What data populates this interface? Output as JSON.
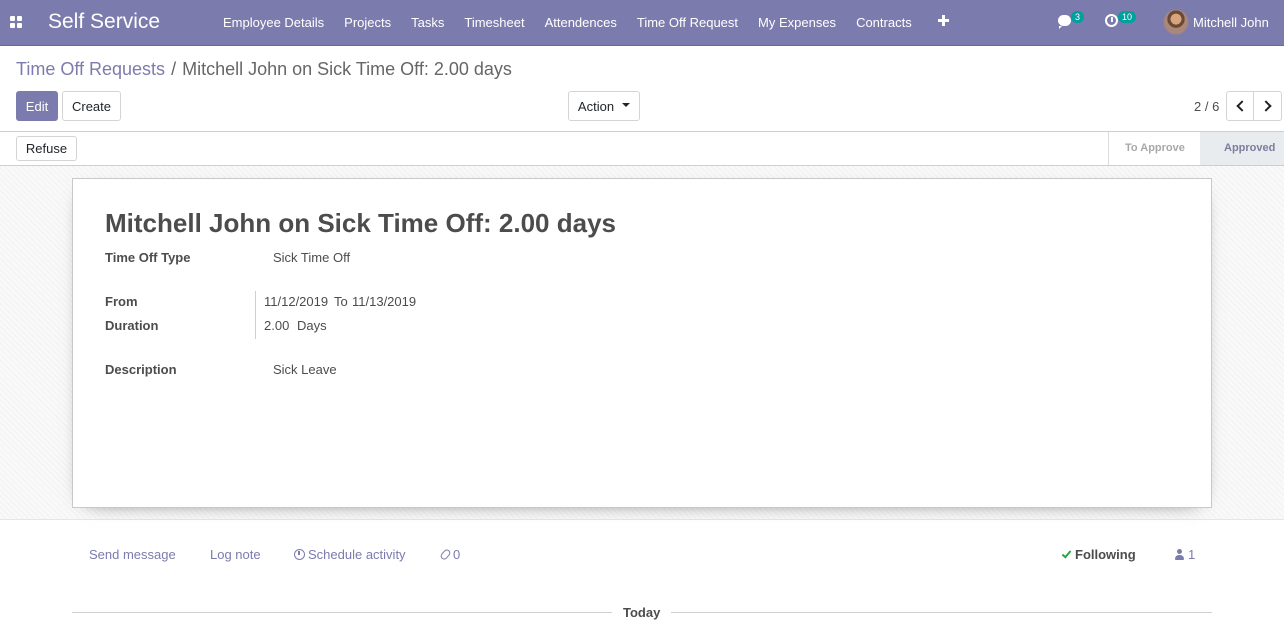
{
  "navbar": {
    "brand": "Self Service",
    "menu": [
      "Employee Details",
      "Projects",
      "Tasks",
      "Timesheet",
      "Attendences",
      "Time Off Request",
      "My Expenses",
      "Contracts"
    ],
    "messages_count": "3",
    "activities_count": "10",
    "user_name": "Mitchell John",
    "accent_color": "#7c7bad"
  },
  "breadcrumb": {
    "parent": "Time Off Requests",
    "separator": "/",
    "current": "Mitchell John on Sick Time Off: 2.00 days"
  },
  "buttons": {
    "edit": "Edit",
    "create": "Create",
    "action": "Action",
    "refuse": "Refuse"
  },
  "pager": {
    "value": "2 / 6"
  },
  "status": {
    "steps": [
      "To Approve",
      "Approved"
    ],
    "current": "Approved"
  },
  "record": {
    "title": "Mitchell John on Sick Time Off: 2.00 days",
    "type_label": "Time Off Type",
    "type_value": "Sick Time Off",
    "from_label": "From",
    "date_from": "11/12/2019",
    "to_word": "To",
    "date_to": "11/13/2019",
    "duration_label": "Duration",
    "duration_value": "2.00",
    "duration_unit": "Days",
    "description_label": "Description",
    "description_value": "Sick Leave"
  },
  "chatter": {
    "send_message": "Send message",
    "log_note": "Log note",
    "schedule_activity": "Schedule activity",
    "attachments": "0",
    "following": "Following",
    "followers": "1",
    "today": "Today"
  }
}
